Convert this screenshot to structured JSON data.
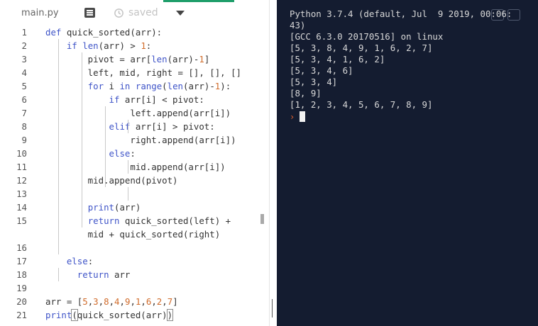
{
  "editor": {
    "file_tab": "main.py",
    "status": "saved",
    "icons": {
      "file": "file-menu-icon",
      "saved": "history-icon",
      "dropdown": "chevron-down-icon"
    },
    "lines": [
      {
        "n": "1",
        "text": "def quick_sorted(arr):"
      },
      {
        "n": "2",
        "text": "    if len(arr) > 1:"
      },
      {
        "n": "3",
        "text": "        pivot = arr[len(arr)-1]"
      },
      {
        "n": "4",
        "text": "        left, mid, right = [], [], []"
      },
      {
        "n": "5",
        "text": "        for i in range(len(arr)-1):"
      },
      {
        "n": "6",
        "text": "            if arr[i] < pivot:"
      },
      {
        "n": "7",
        "text": "                left.append(arr[i])"
      },
      {
        "n": "8",
        "text": "            elif arr[i] > pivot:"
      },
      {
        "n": "9",
        "text": "                right.append(arr[i])"
      },
      {
        "n": "10",
        "text": "            else:"
      },
      {
        "n": "11",
        "text": "                mid.append(arr[i])"
      },
      {
        "n": "12",
        "text": "        mid.append(pivot)"
      },
      {
        "n": "13",
        "text": ""
      },
      {
        "n": "14",
        "text": "        print(arr)"
      },
      {
        "n": "15",
        "text": "        return quick_sorted(left) +"
      },
      {
        "n": "",
        "text": "        mid + quick_sorted(right)"
      },
      {
        "n": "16",
        "text": ""
      },
      {
        "n": "17",
        "text": "    else:"
      },
      {
        "n": "18",
        "text": "      return arr"
      },
      {
        "n": "19",
        "text": ""
      },
      {
        "n": "20",
        "text": "arr = [5,3,8,4,9,1,6,2,7]"
      },
      {
        "n": "21",
        "text": "print(quick_sorted(arr))"
      }
    ]
  },
  "console": {
    "output": [
      "Python 3.7.4 (default, Jul  9 2019, 00:06:",
      "43)",
      "[GCC 6.3.0 20170516] on linux",
      "[5, 3, 8, 4, 9, 1, 6, 2, 7]",
      "[5, 3, 4, 1, 6, 2]",
      "[5, 3, 4, 6]",
      "[5, 3, 4]",
      "[8, 9]",
      "[1, 2, 3, 4, 5, 6, 7, 8, 9]"
    ],
    "prompt": "›"
  },
  "colors": {
    "accent": "#1e9e6a",
    "console_bg": "#141c30",
    "keyword": "#3f54c8",
    "number": "#d06b2a",
    "prompt": "#e8622c"
  }
}
